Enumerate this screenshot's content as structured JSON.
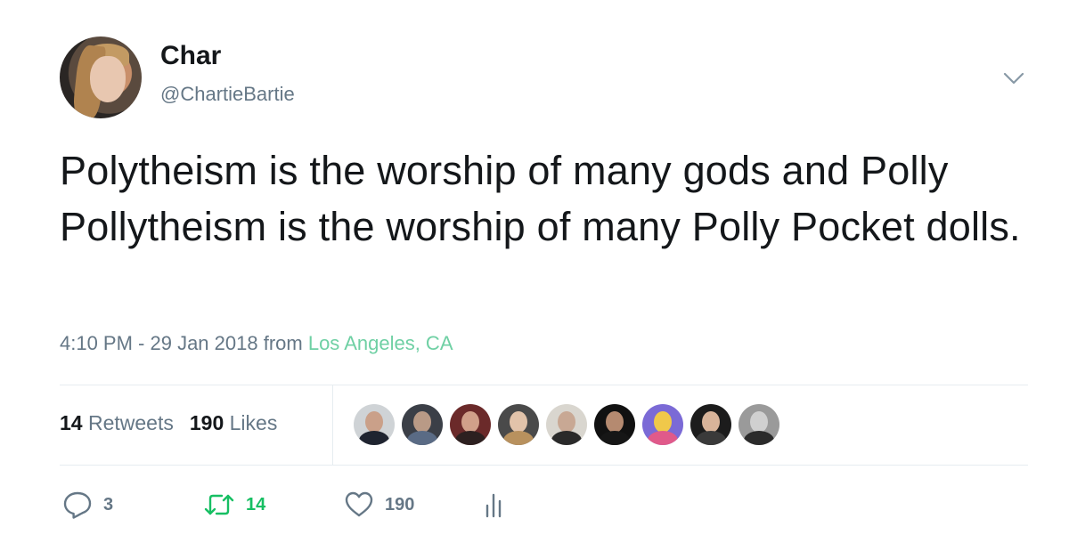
{
  "author": {
    "display_name": "Char",
    "handle": "@ChartieBartie"
  },
  "tweet": {
    "text": "Polytheism is the worship of many gods and Polly Pollytheism is the worship of many Polly Pocket dolls.",
    "time": "4:10 PM - 29 Jan 2018 from ",
    "location": "Los Angeles, CA"
  },
  "stats": {
    "retweets_count": "14",
    "retweets_label": "Retweets",
    "likes_count": "190",
    "likes_label": "Likes"
  },
  "likers": [
    {
      "name": "liker-1"
    },
    {
      "name": "liker-2"
    },
    {
      "name": "liker-3"
    },
    {
      "name": "liker-4"
    },
    {
      "name": "liker-5"
    },
    {
      "name": "liker-6"
    },
    {
      "name": "liker-7"
    },
    {
      "name": "liker-8"
    },
    {
      "name": "liker-9"
    }
  ],
  "actions": {
    "reply_count": "3",
    "retweet_count": "14",
    "like_count": "190"
  },
  "icons": {
    "reply": "reply-icon",
    "retweet": "retweet-icon",
    "like": "heart-icon",
    "analytics": "analytics-icon",
    "menu": "chevron-down-icon"
  },
  "colors": {
    "text": "#14171a",
    "secondary": "#657786",
    "location": "#6fd0a4",
    "retweet": "#17bf63",
    "divider": "#e6ecf0"
  }
}
